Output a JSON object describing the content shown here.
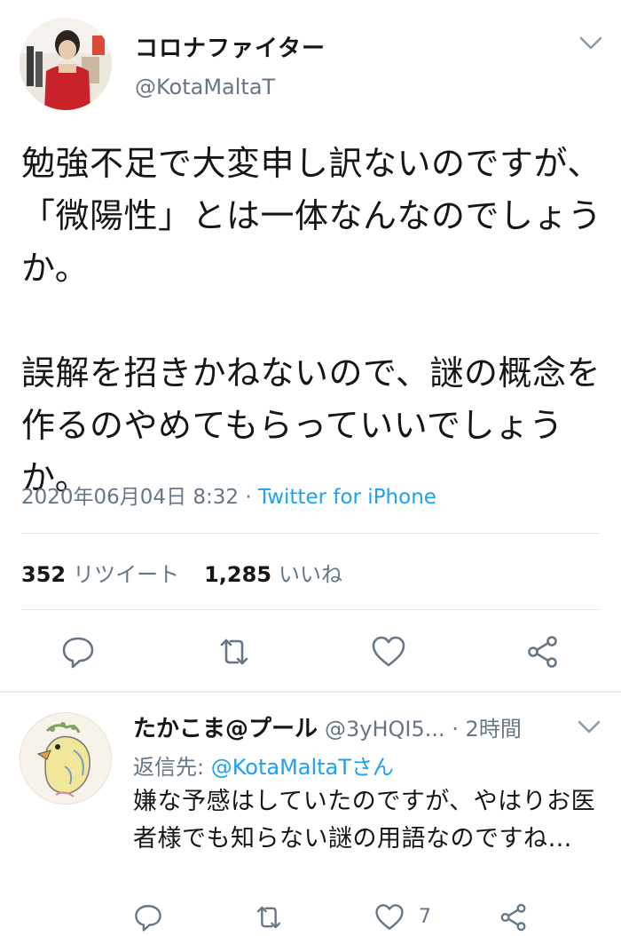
{
  "main_tweet": {
    "display_name": "コロナファイター",
    "handle": "@KotaMaltaT",
    "text": "勉強不足で大変申し訳ないのですが、「微陽性」とは一体なんなのでしょうか。\n\n誤解を招きかねないので、謎の概念を作るのやめてもらっていいでしょうか。",
    "timestamp": "2020年06月04日 8:32",
    "separator": " · ",
    "source": "Twitter for iPhone",
    "retweet_count": "352",
    "retweet_label": "リツイート",
    "like_count": "1,285",
    "like_label": "いいね",
    "actions": [
      "reply-icon",
      "retweet-icon",
      "like-icon",
      "share-icon"
    ]
  },
  "reply_tweet": {
    "display_name": "たかこま@プール",
    "handle": "@3yHQI5...",
    "time": " · 2時間",
    "reply_to_label": "返信先: ",
    "reply_to_mention": "@KotaMaltaTさん",
    "text": "嫌な予感はしていたのですが、やはりお医者様でも知らない謎の用語なのですね…",
    "like_count": "7",
    "actions": [
      "reply-icon",
      "retweet-icon",
      "like-icon",
      "share-icon"
    ]
  },
  "colors": {
    "accent": "#1da1f2",
    "secondary_text": "#657786",
    "primary_text": "#14171a",
    "divider": "#e1e8ed"
  }
}
